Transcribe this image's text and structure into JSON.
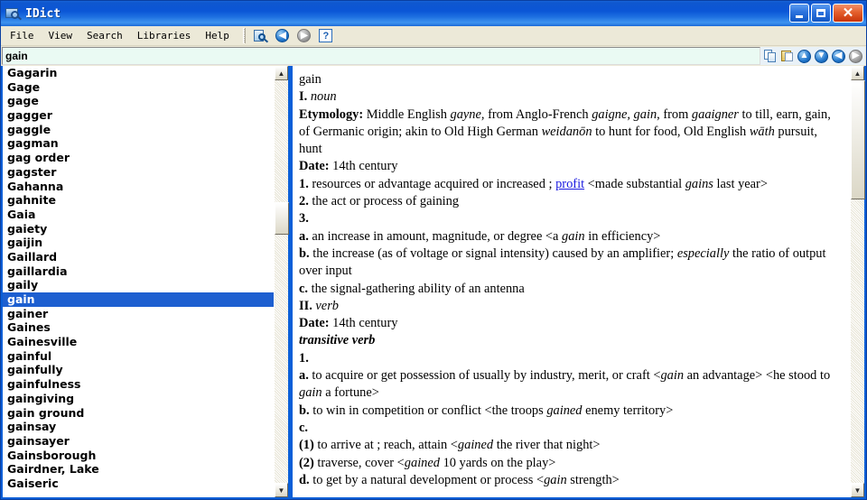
{
  "window": {
    "title": "IDict",
    "icon": "dictionary-magnifier-icon",
    "minimize_label": "_",
    "maximize_label": "□",
    "close_label": "✕"
  },
  "menu": {
    "items": [
      {
        "label": "File"
      },
      {
        "label": "View"
      },
      {
        "label": "Search"
      },
      {
        "label": "Libraries"
      },
      {
        "label": "Help"
      }
    ],
    "toolbar": [
      {
        "name": "search-icon",
        "label": ""
      },
      {
        "name": "back-icon",
        "label": "◀"
      },
      {
        "name": "forward-icon",
        "label": "▶"
      },
      {
        "name": "help-icon",
        "label": "?"
      }
    ]
  },
  "search": {
    "value": "gain",
    "placeholder": "",
    "tools": [
      {
        "name": "copy-icon",
        "label": ""
      },
      {
        "name": "paste-icon",
        "label": ""
      },
      {
        "name": "scroll-up-icon",
        "label": "▲"
      },
      {
        "name": "scroll-down-icon",
        "label": "▼"
      },
      {
        "name": "history-back-icon",
        "label": "◀"
      },
      {
        "name": "history-forward-icon",
        "label": "▶"
      }
    ]
  },
  "wordlist": {
    "selected": "gain",
    "items": [
      "Gagarin",
      "Gage",
      "gage",
      "gagger",
      "gaggle",
      "gagman",
      "gag order",
      "gagster",
      "Gahanna",
      "gahnite",
      "Gaia",
      "gaiety",
      "gaijin",
      "Gaillard",
      "gaillardia",
      "gaily",
      "gain",
      "gainer",
      "Gaines",
      "Gainesville",
      "gainful",
      "gainfully",
      "gainfulness",
      "gaingiving",
      "gain ground",
      "gainsay",
      "gainsayer",
      "Gainsborough",
      "Gairdner, Lake",
      "Gaiseric"
    ]
  },
  "definition": {
    "headword": "gain",
    "entries": [
      {
        "type": "roman",
        "marker": "I.",
        "pos": "noun"
      },
      {
        "type": "etymology",
        "label": "Etymology:",
        "text": "Middle English <i>gayne</i>, from Anglo-French <i>gaigne, gain</i>, from <i>gaaigner</i> to till, earn, gain, of Germanic origin; akin to Old High German <i>weidanōn</i> to hunt for food, Old English <i>wāth</i> pursuit, hunt"
      },
      {
        "type": "date",
        "label": "Date:",
        "text": "14th century"
      },
      {
        "type": "sense",
        "marker": "1.",
        "text": "resources or advantage acquired or increased ; <a>profit</a> &lt;made substantial <i>gains</i> last year&gt;"
      },
      {
        "type": "sense",
        "marker": "2.",
        "text": "the act or process of gaining"
      },
      {
        "type": "sense",
        "marker": "3.",
        "text": ""
      },
      {
        "type": "subsense",
        "marker": "a.",
        "text": "an increase in amount, magnitude, or degree &lt;a <i>gain</i> in efficiency&gt;"
      },
      {
        "type": "subsense",
        "marker": "b.",
        "text": "the increase (as of voltage or signal intensity) caused by an amplifier; <i>especially</i> the ratio of output over input"
      },
      {
        "type": "subsense",
        "marker": "c.",
        "text": "the signal-gathering ability of an antenna"
      },
      {
        "type": "roman",
        "marker": "II.",
        "pos": "verb"
      },
      {
        "type": "date",
        "label": "Date:",
        "text": "14th century"
      },
      {
        "type": "posline",
        "text": "transitive verb"
      },
      {
        "type": "sense",
        "marker": "1.",
        "text": ""
      },
      {
        "type": "subsense",
        "marker": "a.",
        "text": "to acquire or get possession of usually by industry, merit, or craft &lt;<i>gain</i> an advantage&gt; &lt;he stood to <i>gain</i> a fortune&gt;"
      },
      {
        "type": "subsense",
        "marker": "b.",
        "text": "to win in competition or conflict &lt;the troops <i>gained</i> enemy territory&gt;"
      },
      {
        "type": "subsense",
        "marker": "c.",
        "text": ""
      },
      {
        "type": "subsub",
        "marker": "(1)",
        "text": "to arrive at ; reach, attain &lt;<i>gained</i> the river that night&gt;"
      },
      {
        "type": "subsub",
        "marker": "(2)",
        "text": "traverse, cover &lt;<i>gained</i> 10 yards on the play&gt;"
      },
      {
        "type": "subsense",
        "marker": "d.",
        "text": "to get by a natural development or process &lt;<i>gain</i> strength&gt;"
      }
    ],
    "xref_link": "profit"
  },
  "scrollbars": {
    "up_arrow": "▲",
    "down_arrow": "▼"
  },
  "colors": {
    "titlebar": "#0b56d6",
    "selection": "#1d5fd0",
    "search_field": "#eafaf3",
    "chrome": "#ece9d8",
    "link": "#1a1ae0"
  }
}
